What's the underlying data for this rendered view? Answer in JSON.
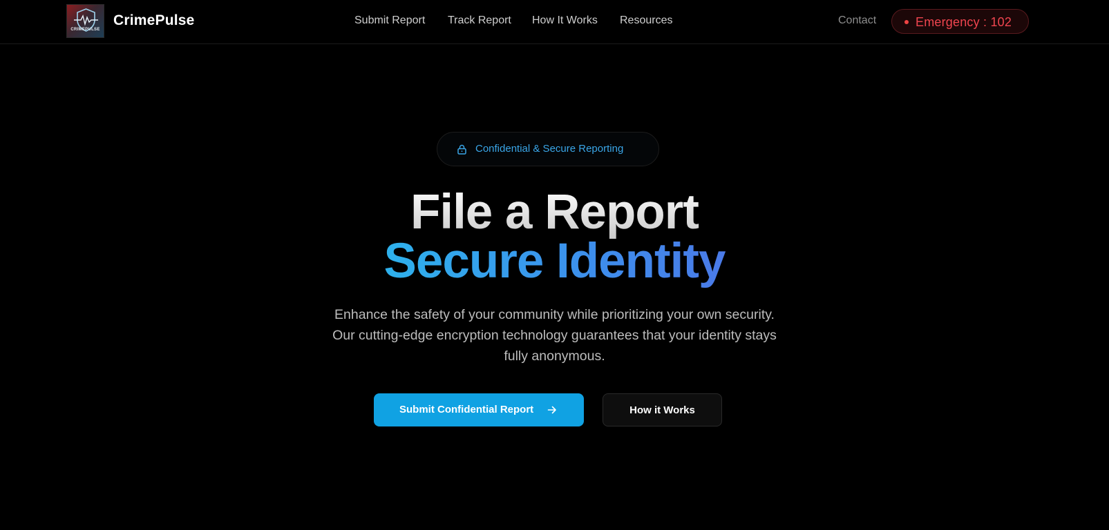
{
  "header": {
    "logo_text": "CRIMEPULSE",
    "brand": "CrimePulse",
    "nav": [
      {
        "label": "Submit Report"
      },
      {
        "label": "Track Report"
      },
      {
        "label": "How It Works"
      },
      {
        "label": "Resources"
      }
    ],
    "contact_label": "Contact",
    "emergency_label": "Emergency : 102"
  },
  "hero": {
    "badge_icon": "lock-icon",
    "badge_text": "Confidential & Secure Reporting",
    "title_line1": "File a Report",
    "title_line2": "Secure Identity",
    "description_lines": [
      "Enhance the safety of your community while prioritizing your own security.",
      "Our cutting-edge encryption technology guarantees that your identity stays",
      "fully anonymous."
    ],
    "primary_button": {
      "label": "Submit Confidential Report",
      "icon": "arrow-right-icon"
    },
    "secondary_button": {
      "label": "How it Works"
    }
  },
  "colors": {
    "background": "#000000",
    "accent": "#10a2e3",
    "badge_text": "#3aa6e8",
    "emergency": "#f0454f",
    "title_gradient_start": "#2eb1ec",
    "title_gradient_end": "#4a7ae8"
  }
}
